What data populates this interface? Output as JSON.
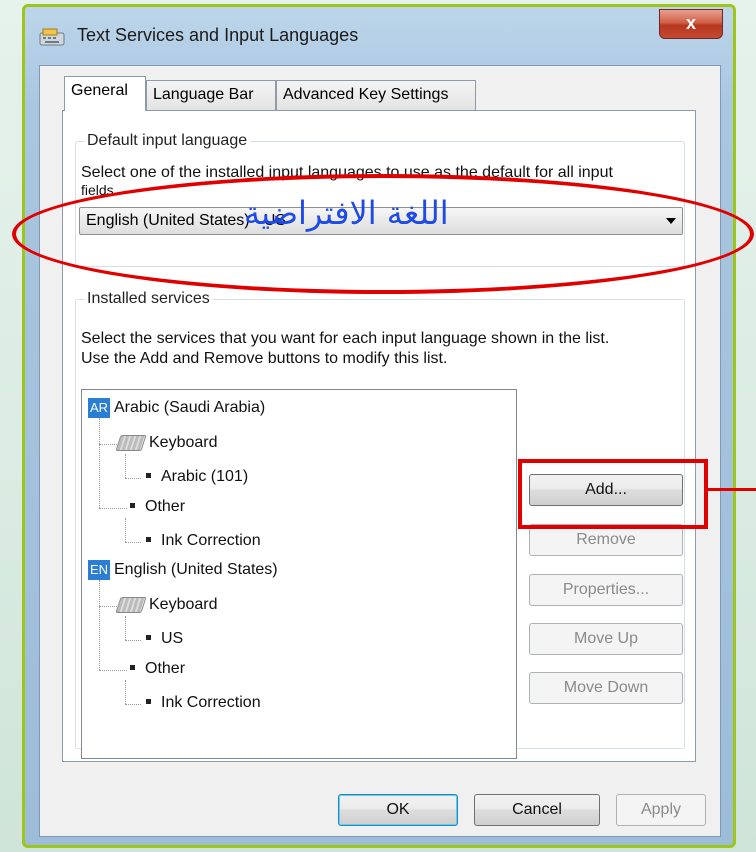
{
  "window": {
    "title": "Text Services and Input Languages",
    "close_glyph": "x"
  },
  "tabs": [
    {
      "label": "General",
      "active": true
    },
    {
      "label": "Language Bar",
      "active": false
    },
    {
      "label": "Advanced Key Settings",
      "active": false
    }
  ],
  "default_input": {
    "group_label": "Default input language",
    "description_line1": "Select one of the installed input languages to use as the default for all input",
    "description_line2": "fields.",
    "selected_value": "English (United States) - US"
  },
  "installed_services": {
    "group_label": "Installed services",
    "description_line1": "Select the services that you want for each input language shown in the list.",
    "description_line2": "Use the Add and Remove buttons to modify this list.",
    "tree": [
      {
        "badge": "AR",
        "label": "Arabic (Saudi Arabia)"
      },
      {
        "label": "Keyboard"
      },
      {
        "label": "Arabic (101)"
      },
      {
        "label": "Other"
      },
      {
        "label": "Ink Correction"
      },
      {
        "badge": "EN",
        "label": "English (United States)"
      },
      {
        "label": "Keyboard"
      },
      {
        "label": "US"
      },
      {
        "label": "Other"
      },
      {
        "label": "Ink Correction"
      }
    ],
    "buttons": {
      "add": "Add...",
      "remove": "Remove",
      "properties": "Properties...",
      "move_up": "Move Up",
      "move_down": "Move Down"
    }
  },
  "footer": {
    "ok": "OK",
    "cancel": "Cancel",
    "apply": "Apply"
  },
  "annotation": {
    "arabic_text": "اللغة الافتراضية",
    "color": "#e10000",
    "text_color": "#1e4be8"
  }
}
